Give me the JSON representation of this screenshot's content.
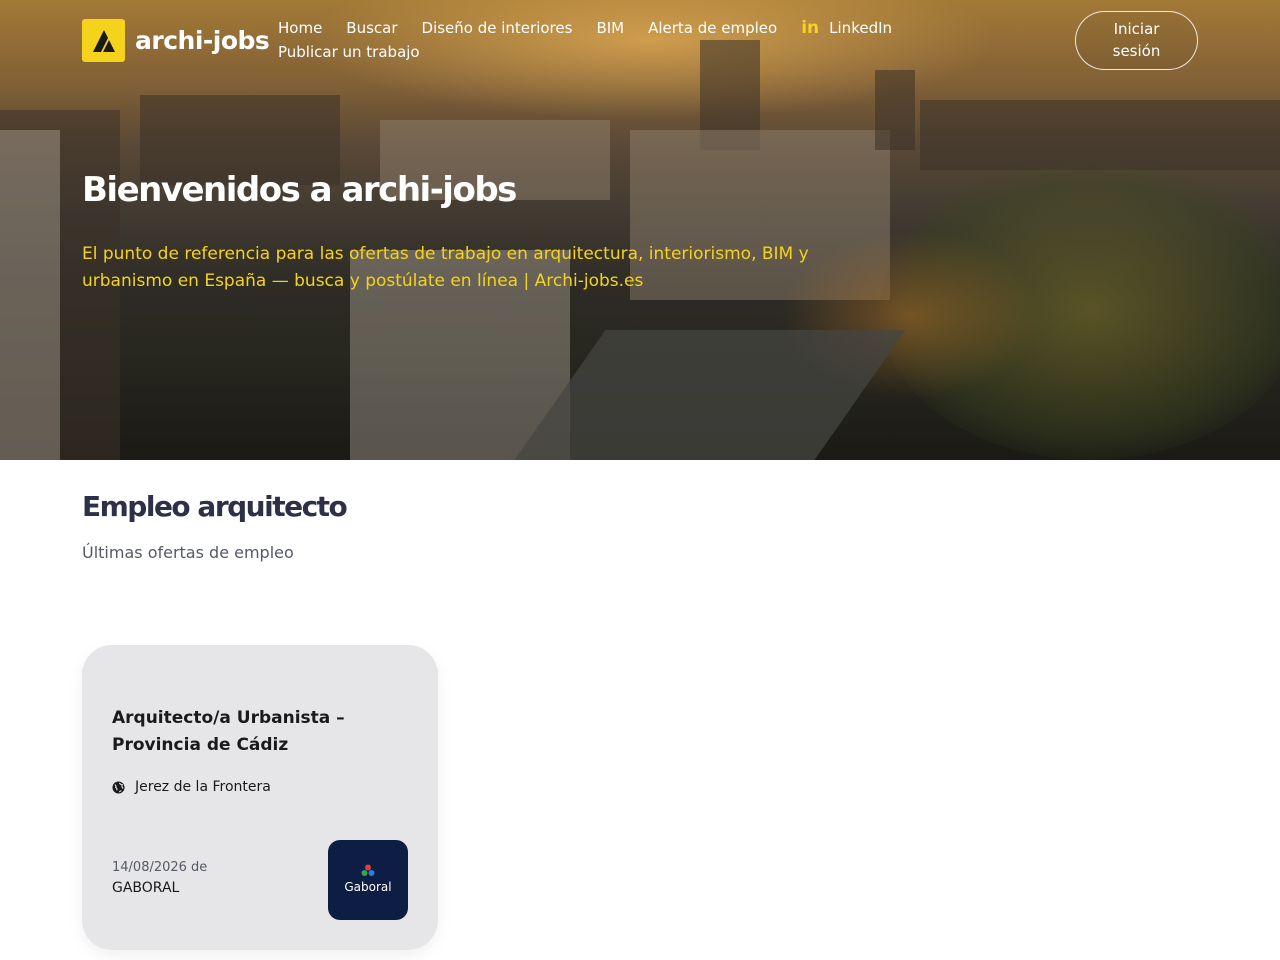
{
  "brand": {
    "name": "archi-jobs",
    "logo_color": "#f5d31c"
  },
  "nav": {
    "items": [
      {
        "label": "Home"
      },
      {
        "label": "Buscar"
      },
      {
        "label": "Diseño de interiores"
      },
      {
        "label": "BIM"
      },
      {
        "label": "Alerta de empleo"
      }
    ],
    "linkedin": {
      "label": "LinkedIn",
      "icon": "linkedin-icon"
    },
    "post_job": "Publicar un trabajo",
    "login_line1": "Iniciar",
    "login_line2": "sesión"
  },
  "hero": {
    "title": "Bienvenidos a archi-jobs",
    "subtitle": "El punto de referencia para las ofertas de trabajo en arquitectura, interiorismo, BIM y urbanismo en España — busca y postúlate en línea | Archi-jobs.es",
    "accent": "#f5d31c"
  },
  "section": {
    "title": "Empleo arquitecto",
    "subtitle": "Últimas ofertas de empleo"
  },
  "jobs": [
    {
      "title": "Arquitecto/a Urbanista – Provincia de Cádiz",
      "location": "Jerez de la Frontera",
      "location_icon": "globe-icon",
      "date_line": "14/08/2026 de",
      "company": "GABORAL",
      "company_logo_text": "Gaboral",
      "company_logo_bg": "#0e1d44"
    }
  ]
}
